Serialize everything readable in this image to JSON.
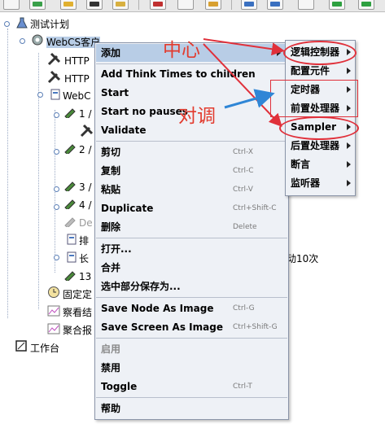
{
  "tree": {
    "items": [
      {
        "label": "测试计划"
      },
      {
        "label": "WebCS客户"
      },
      {
        "label": "HTTP"
      },
      {
        "label": "HTTP"
      },
      {
        "label": "WebC"
      },
      {
        "label": "1 /"
      },
      {
        "label": ""
      },
      {
        "label": "2 /"
      },
      {
        "label": "3 /"
      },
      {
        "label": "4 /"
      },
      {
        "label": "De"
      },
      {
        "label": "排"
      },
      {
        "label": "长"
      },
      {
        "label": "13"
      },
      {
        "label": "固定定"
      },
      {
        "label": "察看结"
      },
      {
        "label": "聚合报"
      },
      {
        "label": "工作台"
      }
    ],
    "trailing_text": "动10次"
  },
  "context_menu": {
    "items": [
      {
        "label": "添加",
        "shortcut": ""
      },
      {
        "label": "Add Think Times to children",
        "shortcut": ""
      },
      {
        "label": "Start",
        "shortcut": ""
      },
      {
        "label": "Start no pauses",
        "shortcut": ""
      },
      {
        "label": "Validate",
        "shortcut": ""
      },
      {
        "label": "剪切",
        "shortcut": "Ctrl-X"
      },
      {
        "label": "复制",
        "shortcut": "Ctrl-C"
      },
      {
        "label": "粘贴",
        "shortcut": "Ctrl-V"
      },
      {
        "label": "Duplicate",
        "shortcut": "Ctrl+Shift-C"
      },
      {
        "label": "删除",
        "shortcut": "Delete"
      },
      {
        "label": "打开...",
        "shortcut": ""
      },
      {
        "label": "合并",
        "shortcut": ""
      },
      {
        "label": "选中部分保存为...",
        "shortcut": ""
      },
      {
        "label": "Save Node As Image",
        "shortcut": "Ctrl-G"
      },
      {
        "label": "Save Screen As Image",
        "shortcut": "Ctrl+Shift-G"
      },
      {
        "label": "启用",
        "shortcut": ""
      },
      {
        "label": "禁用",
        "shortcut": ""
      },
      {
        "label": "Toggle",
        "shortcut": "Ctrl-T"
      },
      {
        "label": "帮助",
        "shortcut": ""
      }
    ]
  },
  "submenu": {
    "items": [
      {
        "label": "逻辑控制器"
      },
      {
        "label": "配置元件"
      },
      {
        "label": "定时器"
      },
      {
        "label": "前置处理器"
      },
      {
        "label": "Sampler"
      },
      {
        "label": "后置处理器"
      },
      {
        "label": "断言"
      },
      {
        "label": "监听器"
      }
    ]
  },
  "annotations": {
    "center_label": "中心",
    "swap_label": "对调",
    "color": "#e23b2e"
  }
}
